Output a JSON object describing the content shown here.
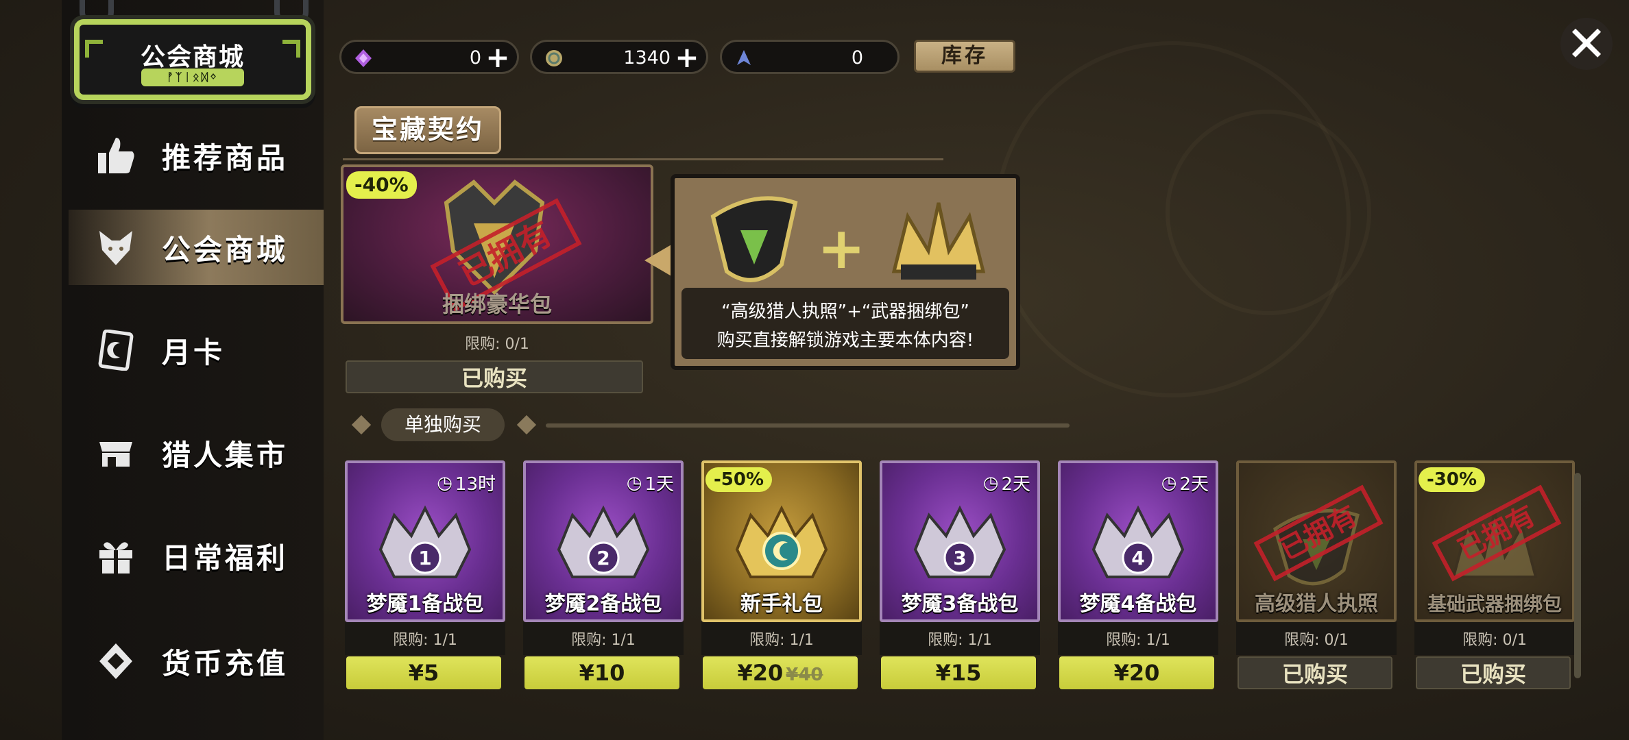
{
  "sidebar": {
    "title": "公会商城",
    "title_sub": "ᚡᛉᛁᛟᛞᛜ",
    "items": [
      {
        "label": "推荐商品",
        "icon": "thumbs-up-icon"
      },
      {
        "label": "公会商城",
        "icon": "fox-head-icon",
        "active": true
      },
      {
        "label": "月卡",
        "icon": "card-icon"
      },
      {
        "label": "猎人集市",
        "icon": "market-stall-icon"
      },
      {
        "label": "日常福利",
        "icon": "gift-box-icon"
      },
      {
        "label": "货币充值",
        "icon": "gem-tag-icon"
      }
    ]
  },
  "currency": {
    "gems": "0",
    "coins": "1340",
    "tokens": "0",
    "stock_label": "库存"
  },
  "section": {
    "title": "宝藏契约"
  },
  "featured": {
    "discount": "-40%",
    "stamp": "已拥有",
    "name": "捆绑豪华包",
    "limit": "限购: 0/1",
    "button": "已购买",
    "info_line1": "“高级猎人执照”+“武器捆绑包”",
    "info_line2": "购买直接解锁游戏主要本体内容!"
  },
  "single": {
    "label": "单独购买"
  },
  "products": [
    {
      "name": "梦魇1备战包",
      "timer": "13时",
      "number": "1",
      "limit": "限购: 1/1",
      "price": "¥5",
      "style": "purple"
    },
    {
      "name": "梦魇2备战包",
      "timer": "1天",
      "number": "2",
      "limit": "限购: 1/1",
      "price": "¥10",
      "style": "purple"
    },
    {
      "name": "新手礼包",
      "discount": "-50%",
      "limit": "限购: 1/1",
      "price": "¥20",
      "old_price": "¥40",
      "style": "gold"
    },
    {
      "name": "梦魇3备战包",
      "timer": "2天",
      "number": "3",
      "limit": "限购: 1/1",
      "price": "¥15",
      "style": "purple"
    },
    {
      "name": "梦魇4备战包",
      "timer": "2天",
      "number": "4",
      "limit": "限购: 1/1",
      "price": "¥20",
      "style": "purple"
    },
    {
      "name": "高级猎人执照",
      "stamp": "已拥有",
      "limit": "限购: 0/1",
      "button": "已购买",
      "style": "owned"
    },
    {
      "name": "基础武器捆绑包",
      "discount": "-30%",
      "stamp": "已拥有",
      "limit": "限购: 0/1",
      "button": "已购买",
      "style": "owned"
    }
  ],
  "colors": {
    "accent_green": "#b7d45c",
    "price_yellow": "#dfe45b",
    "stamp_red": "#c4202a",
    "purple_card": "#6a2f92"
  }
}
